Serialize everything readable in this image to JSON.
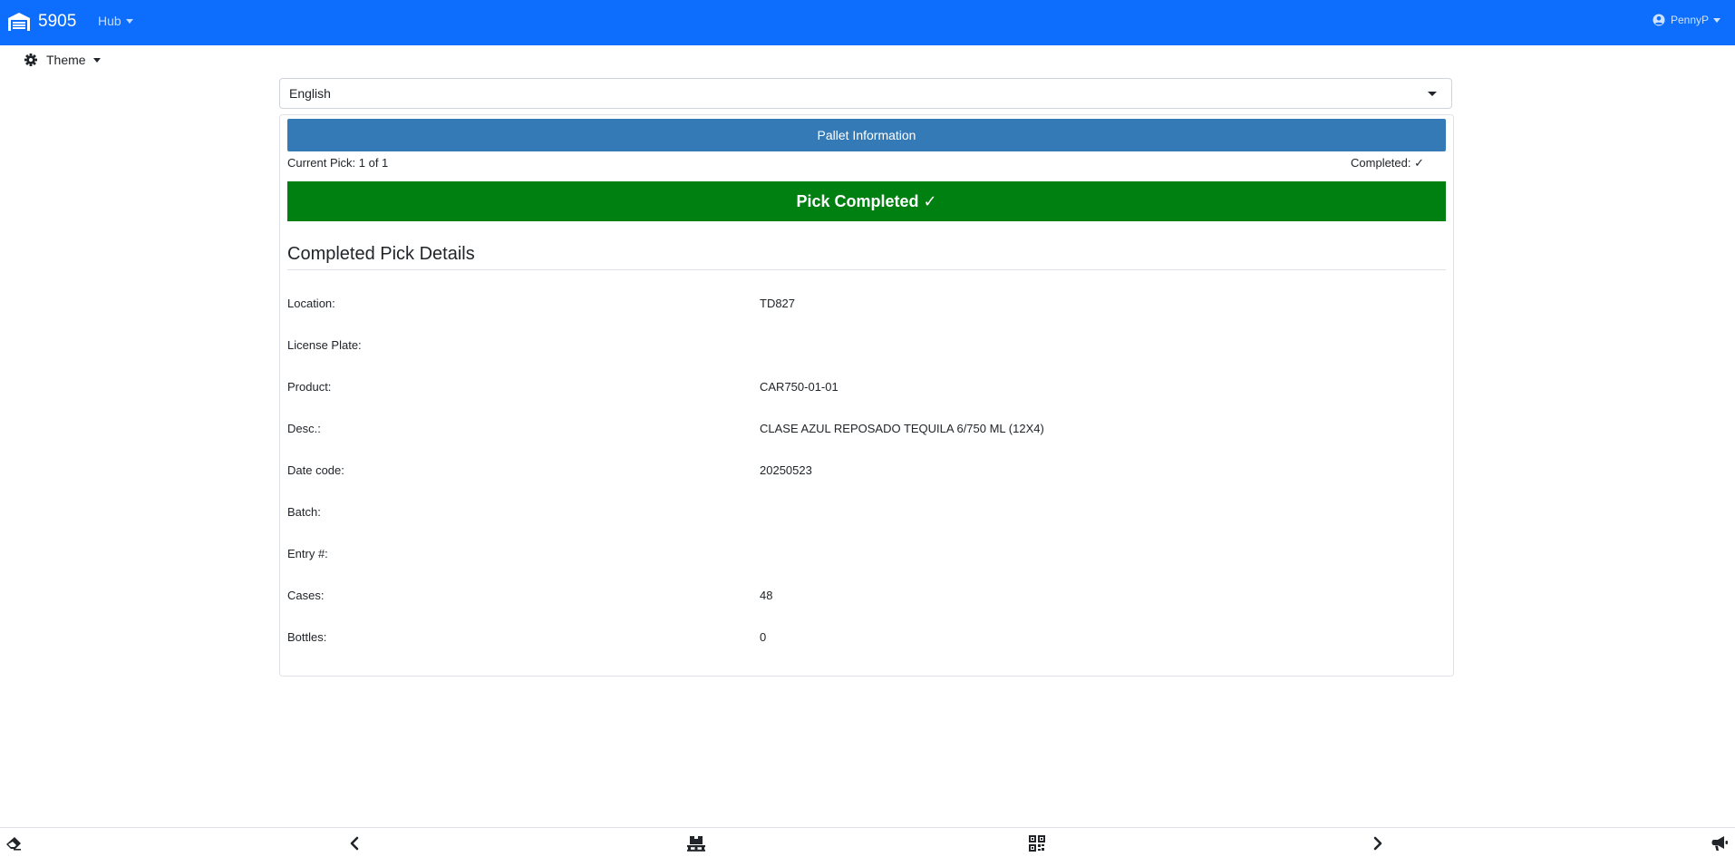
{
  "navbar": {
    "brand": "5905",
    "hub_label": "Hub",
    "user_label": "PennyP",
    "color": "#0d6efd"
  },
  "theme": {
    "label": "Theme"
  },
  "language": {
    "selected": "English"
  },
  "pallet": {
    "button_label": "Pallet Information",
    "current_pick": "Current Pick: 1 of 1",
    "completed": "Completed: ✓",
    "banner": "Pick Completed ✓",
    "banner_color": "#008011"
  },
  "details": {
    "heading": "Completed Pick Details",
    "rows": [
      {
        "label": "Location:",
        "value": "TD827"
      },
      {
        "label": "License Plate:",
        "value": ""
      },
      {
        "label": "Product:",
        "value": "CAR750-01-01"
      },
      {
        "label": "Desc.:",
        "value": "CLASE AZUL REPOSADO TEQUILA 6/750 ML (12X4)"
      },
      {
        "label": "Date code:",
        "value": "20250523"
      },
      {
        "label": "Batch:",
        "value": ""
      },
      {
        "label": "Entry #:",
        "value": ""
      },
      {
        "label": "Cases:",
        "value": "48"
      },
      {
        "label": "Bottles:",
        "value": "0"
      }
    ]
  },
  "toolbar": {
    "icons": [
      "eraser-icon",
      "chevron-left-icon",
      "pallet-icon",
      "qrcode-icon",
      "chevron-right-icon",
      "megaphone-icon"
    ]
  }
}
